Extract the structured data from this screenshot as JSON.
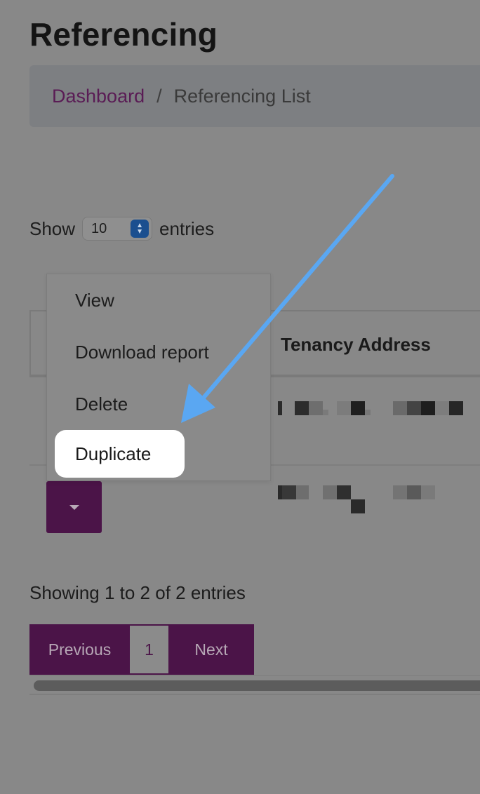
{
  "page": {
    "title": "Referencing"
  },
  "breadcrumb": {
    "link": "Dashboard",
    "separator": "/",
    "current": "Referencing List"
  },
  "entries_control": {
    "prefix": "Show",
    "value": "10",
    "suffix": "entries"
  },
  "table": {
    "columns": [
      "Tenancy Address"
    ]
  },
  "dropdown": {
    "items": [
      "View",
      "Download report",
      "Delete",
      "Duplicate"
    ],
    "highlighted": "Duplicate"
  },
  "info": {
    "text": "Showing 1 to 2 of 2 entries"
  },
  "pagination": {
    "previous": "Previous",
    "current": "1",
    "next": "Next"
  },
  "colors": {
    "overlay": "#888888",
    "brand": "#4b1448",
    "link": "#5a1c55",
    "arrow": "#5aa7f2",
    "highlight": "#ffffff"
  },
  "icons": {
    "action_button": "caret-down-icon",
    "select": "select-arrows-icon",
    "annotation": "arrow-annotation"
  }
}
